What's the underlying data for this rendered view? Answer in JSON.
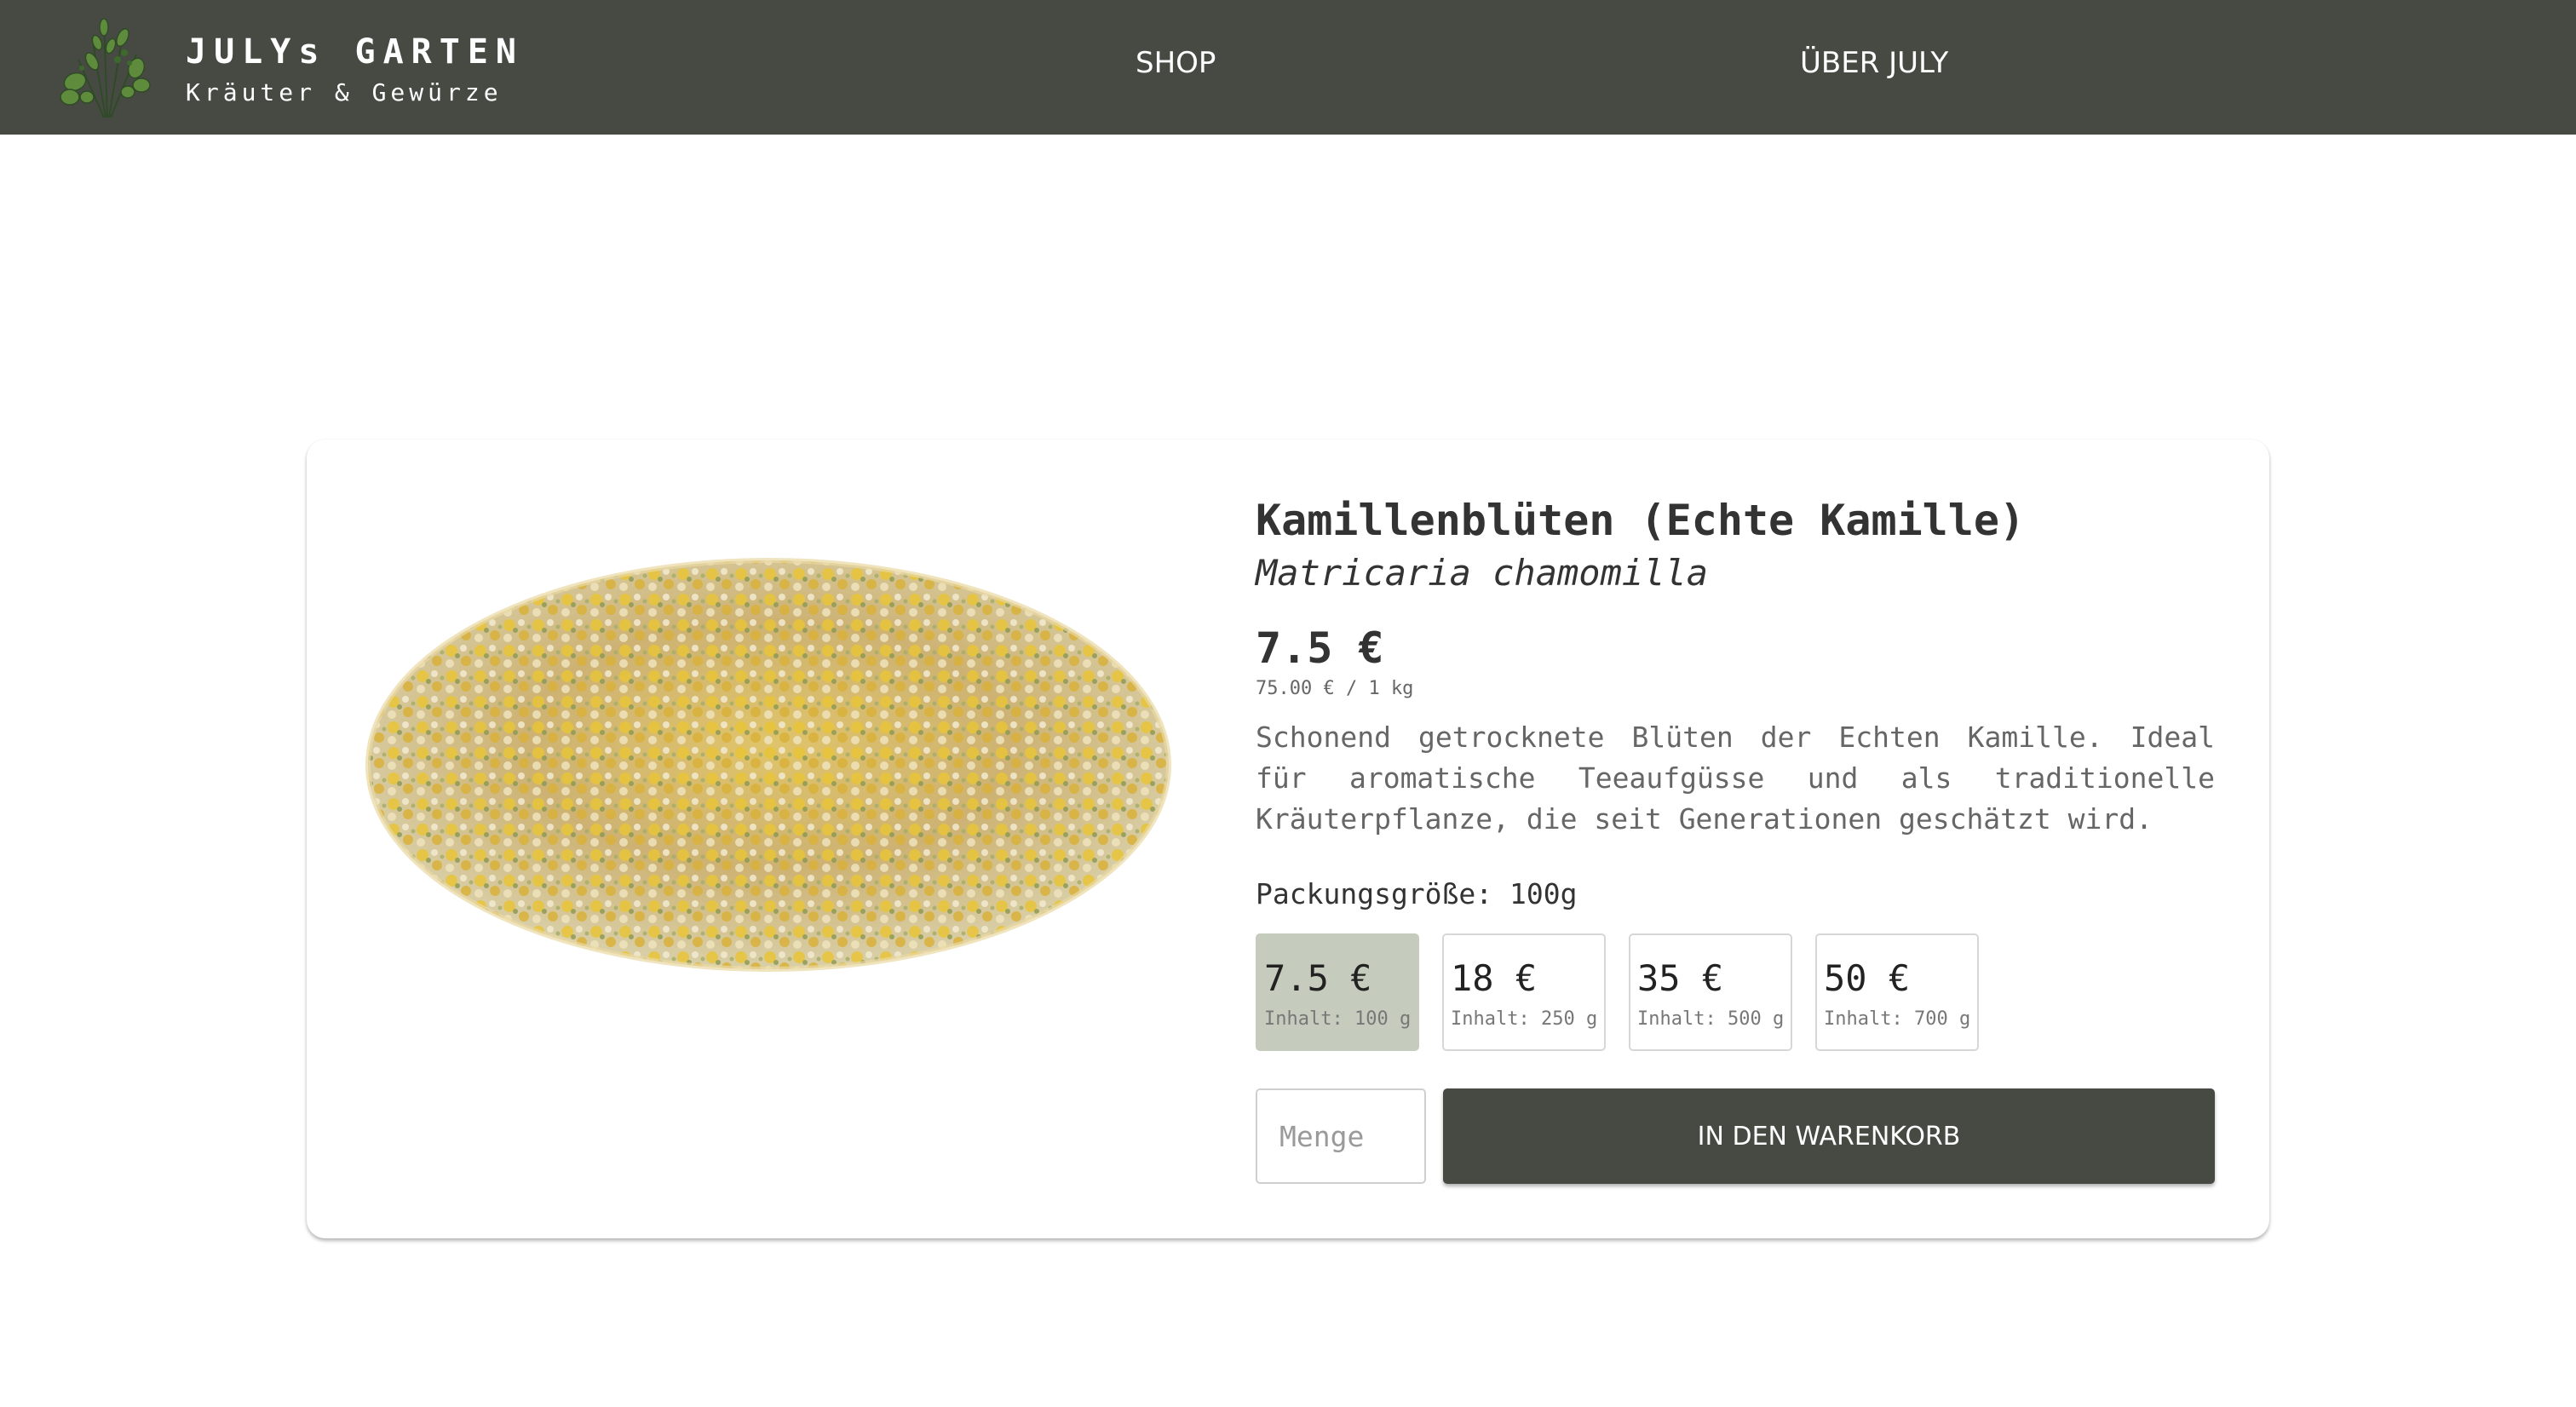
{
  "header": {
    "brand_title": "JULYs GARTEN",
    "brand_subtitle": "Kräuter & Gewürze",
    "nav": [
      {
        "label": "SHOP"
      },
      {
        "label": "ÜBER JULY"
      }
    ]
  },
  "product": {
    "title": "Kamillenblüten (Echte Kamille)",
    "latin_name": "Matricaria chamomilla",
    "price": "7.5 €",
    "unit_price": "75.00 € / 1 kg",
    "description": "Schonend getrocknete Blüten der Echten Kamille. Ideal für aromatische Teeaufgüsse und als traditionelle Kräuterpflanze, die seit Generationen geschätzt wird.",
    "pack_size_label": "Packungsgröße: 100g",
    "variants": [
      {
        "price": "7.5 €",
        "content": "Inhalt: 100 g",
        "selected": true
      },
      {
        "price": "18 €",
        "content": "Inhalt: 250 g",
        "selected": false
      },
      {
        "price": "35 €",
        "content": "Inhalt: 500 g",
        "selected": false
      },
      {
        "price": "50 €",
        "content": "Inhalt: 700 g",
        "selected": false
      }
    ],
    "quantity": {
      "value": "",
      "placeholder": "Menge"
    },
    "add_to_cart_label": "IN DEN WARENKORB"
  },
  "colors": {
    "header_bg": "#474a43",
    "selected_variant_bg": "#c5ccbd",
    "button_bg": "#474a43"
  },
  "icons": {
    "logo": "herb-bundle-logo",
    "product_image": "dried-chamomile-flowers"
  }
}
